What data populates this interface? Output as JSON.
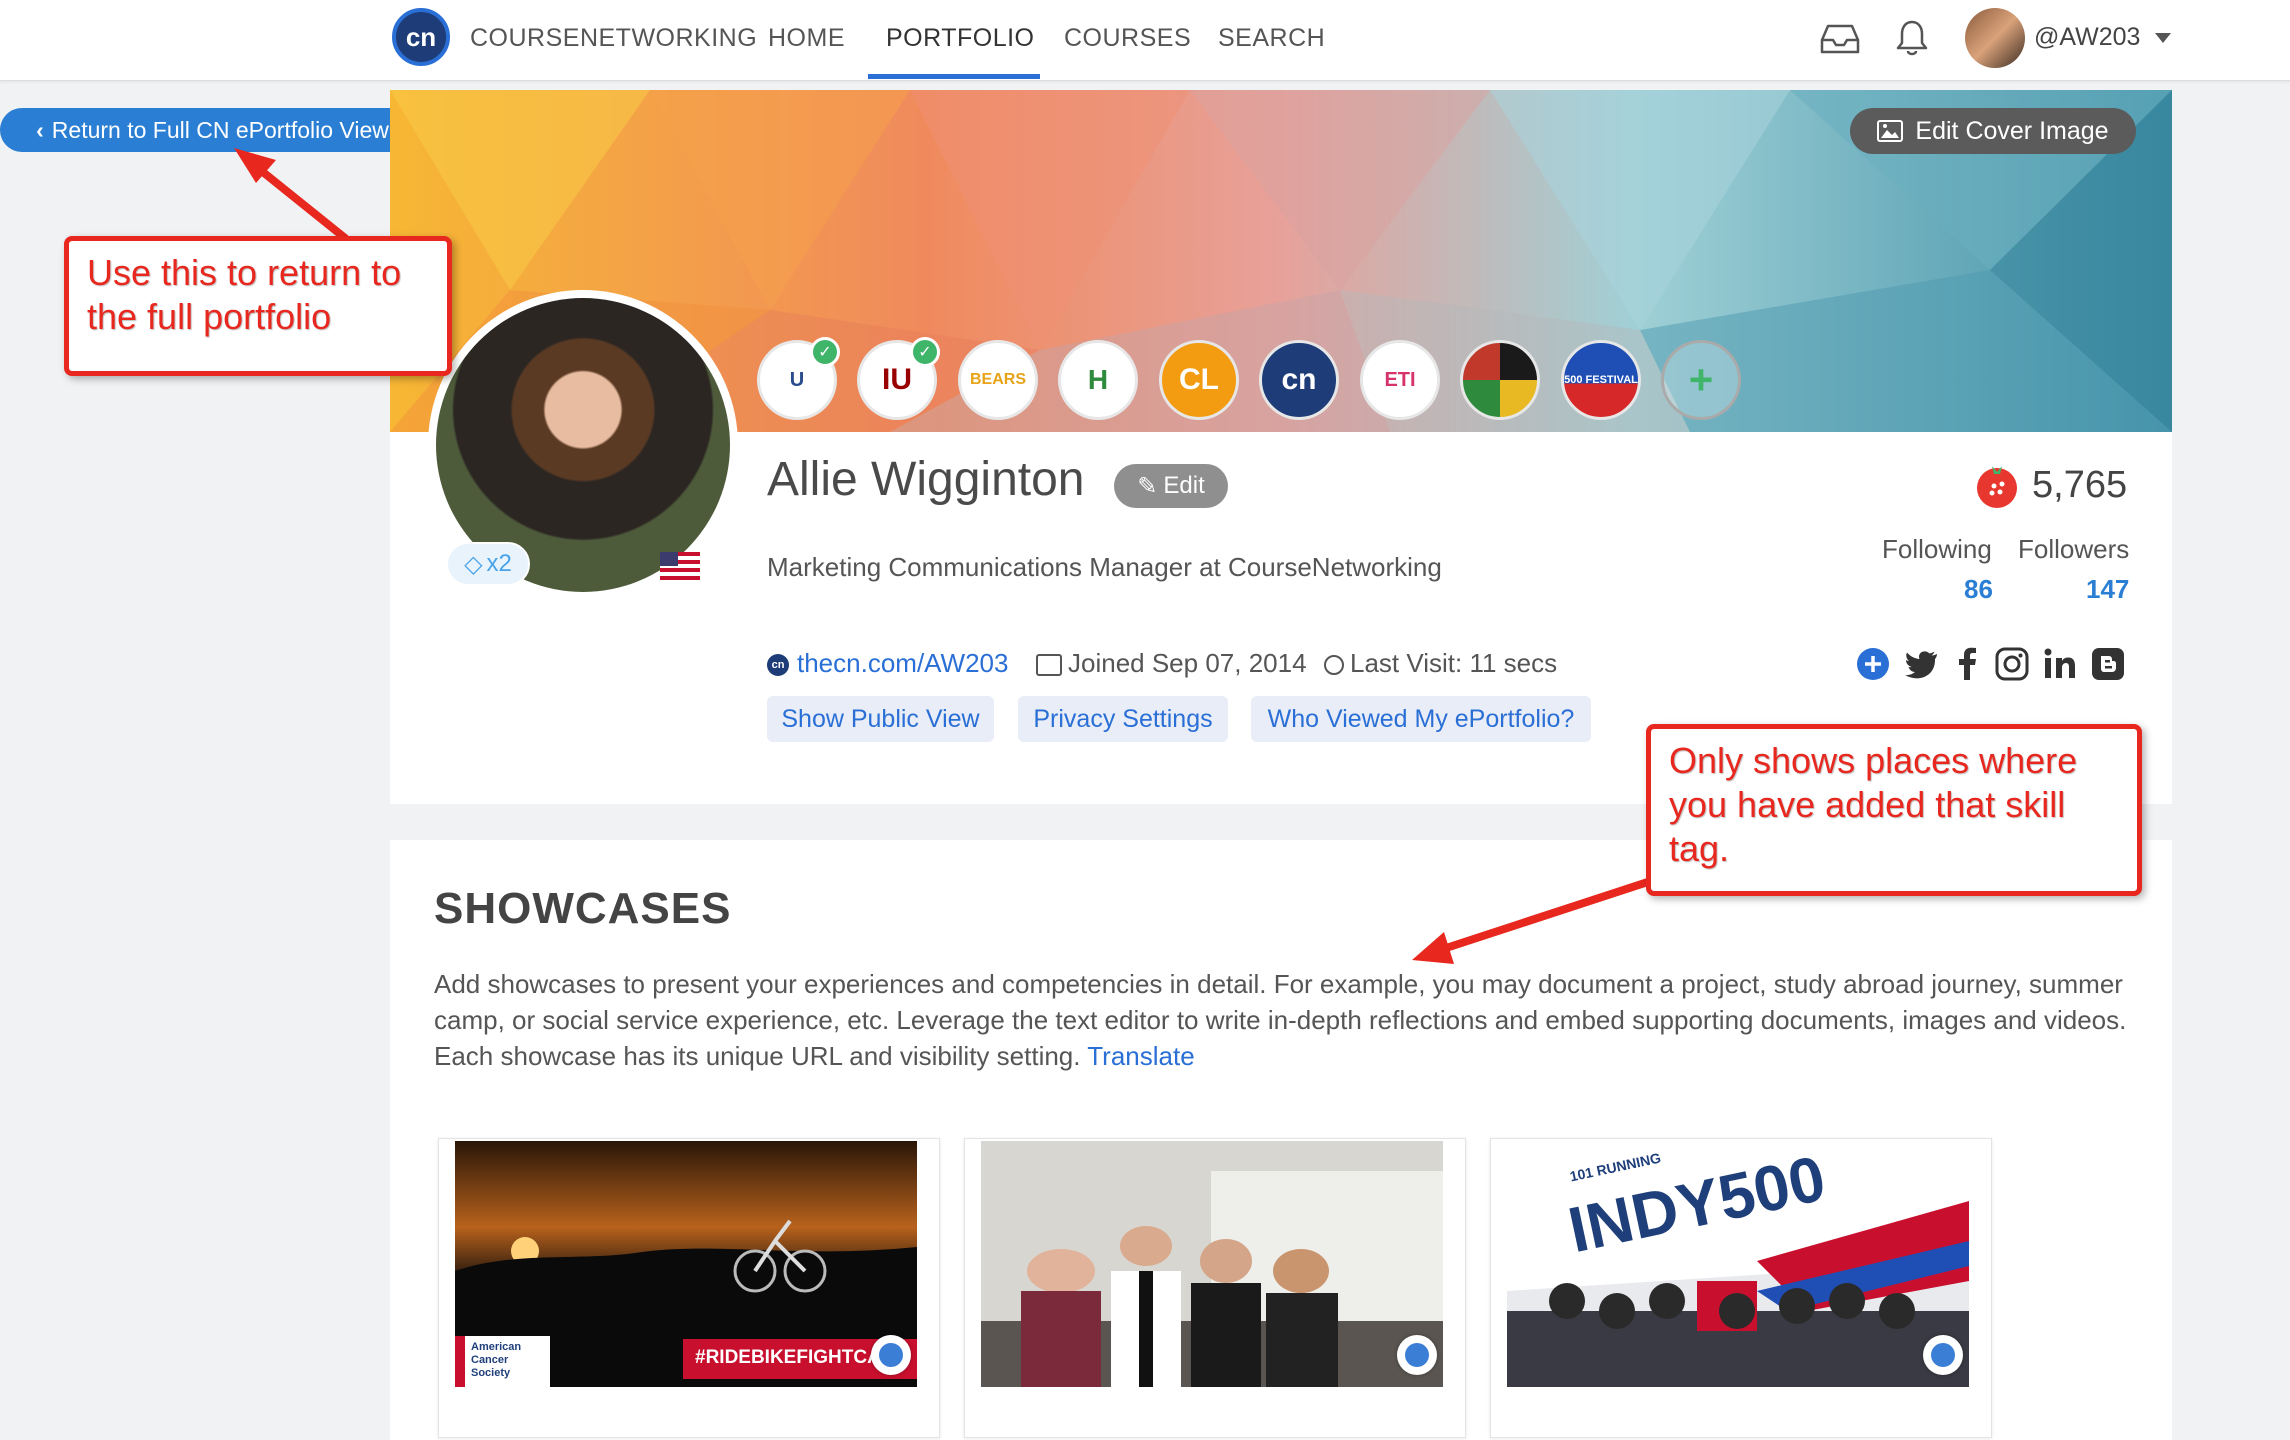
{
  "nav": {
    "brand": "COURSENETWORKING",
    "logo_text": "cn",
    "items": [
      {
        "label": "HOME"
      },
      {
        "label": "PORTFOLIO"
      },
      {
        "label": "COURSES"
      },
      {
        "label": "SEARCH"
      }
    ],
    "active": "PORTFOLIO",
    "username": "@AW203",
    "icons": [
      "inbox-icon",
      "bell-icon",
      "chevron-down-icon"
    ]
  },
  "return_button": {
    "label": "Return to Full CN ePortfolio View"
  },
  "cover": {
    "edit_label": "Edit Cover Image"
  },
  "badges": [
    {
      "text": "U",
      "checked": true
    },
    {
      "text": "IU",
      "checked": true
    },
    {
      "text": "BEARS",
      "checked": false
    },
    {
      "text": "H",
      "checked": false
    },
    {
      "text": "CL",
      "checked": false
    },
    {
      "text": "cn",
      "checked": false
    },
    {
      "text": "ETI",
      "checked": false
    },
    {
      "text": "",
      "checked": false
    },
    {
      "text": "500 FESTIVAL",
      "checked": false
    },
    {
      "text": "+",
      "checked": false
    }
  ],
  "profile": {
    "name": "Allie Wigginton",
    "edit_label": "Edit",
    "gem_label": "x2",
    "headline": "Marketing Communications Manager at CourseNetworking",
    "points": "5,765",
    "following_label": "Following",
    "following_count": "86",
    "followers_label": "Followers",
    "followers_count": "147",
    "url": "thecn.com/AW203",
    "joined": "Joined Sep 07, 2014",
    "last_visit": "Last Visit: 11 secs",
    "buttons": {
      "public_view": "Show Public View",
      "privacy": "Privacy Settings",
      "who_viewed": "Who Viewed My ePortfolio?"
    },
    "social_icons": [
      "plus-circle-icon",
      "twitter-icon",
      "facebook-icon",
      "instagram-icon",
      "linkedin-icon",
      "blogger-icon"
    ]
  },
  "showcases": {
    "title": "SHOWCASES",
    "description": "Add showcases to present your experiences and competencies in detail. For example, you may document a project, study abroad journey, summer camp, or social service experience, etc. Leverage the text editor to write in-depth reflections and embed supporting documents, images and videos. Each showcase has its unique URL and visibility setting.",
    "translate": "Translate",
    "cards": [
      {
        "overlay_text": "#RIDEBIKEFIGHTCA",
        "corner_text": "American Cancer Society"
      },
      {
        "overlay_text": "",
        "corner_text": ""
      },
      {
        "overlay_text": "INDY500",
        "corner_text": "101 RUNNING"
      }
    ]
  },
  "annotations": {
    "return_note": "Use this to return to the full portfolio",
    "skill_note": "Only shows places where you have added that skill tag."
  },
  "colors": {
    "accent": "#2a7fd4",
    "callout": "#e8281f"
  }
}
